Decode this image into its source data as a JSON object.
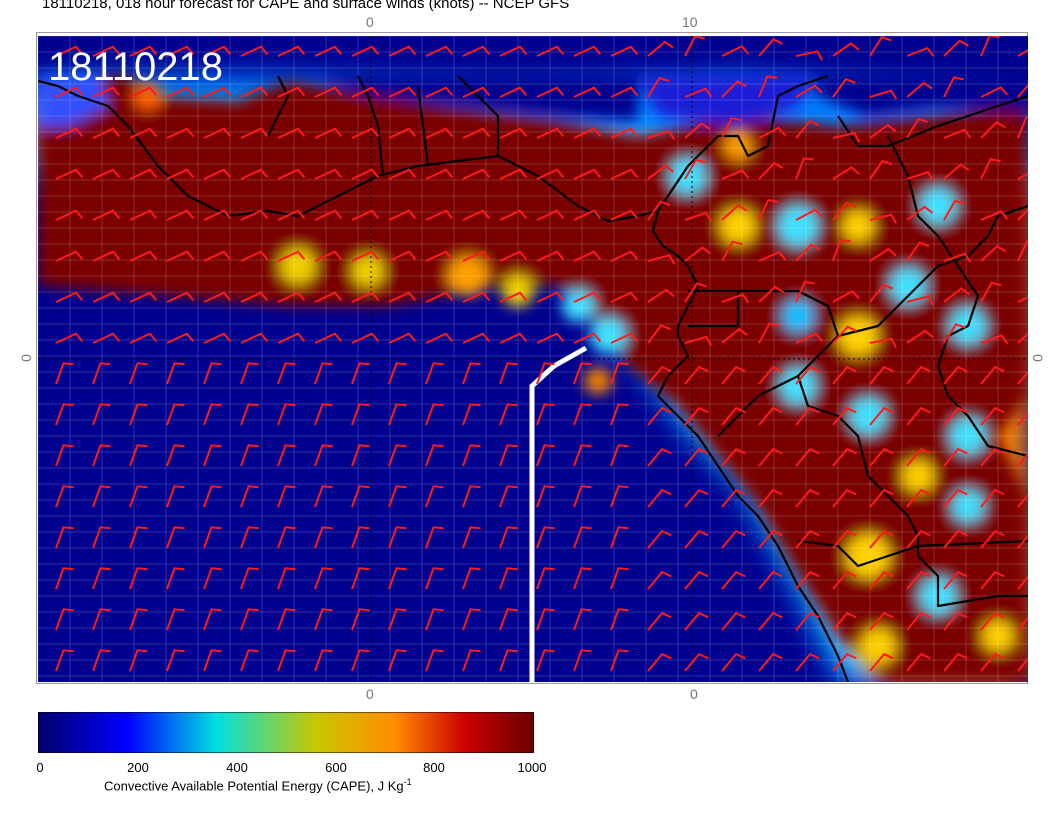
{
  "title": "18110218, 018 hour forecast for CAPE and surface winds (knots) -- NCEP GFS",
  "stamp": "18110218",
  "map": {
    "lon_labels_top": [
      "0",
      "10"
    ],
    "lon_labels_bottom": [
      "0",
      "0"
    ],
    "lat_label_left": "0",
    "lat_label_right": "0",
    "barb_color": "#ff1a1a",
    "coast_color": "#000000",
    "track_color": "#ffffff"
  },
  "colorbar": {
    "ticks": [
      "0",
      "200",
      "400",
      "600",
      "800",
      "1000"
    ],
    "label_text": "Convective Available Potential Energy (CAPE), J Kg",
    "label_sup": "-1",
    "colors": [
      "#00008b",
      "#0000ff",
      "#00ffff",
      "#c8c800",
      "#ff8c00",
      "#cc0000",
      "#7a0000"
    ]
  }
}
